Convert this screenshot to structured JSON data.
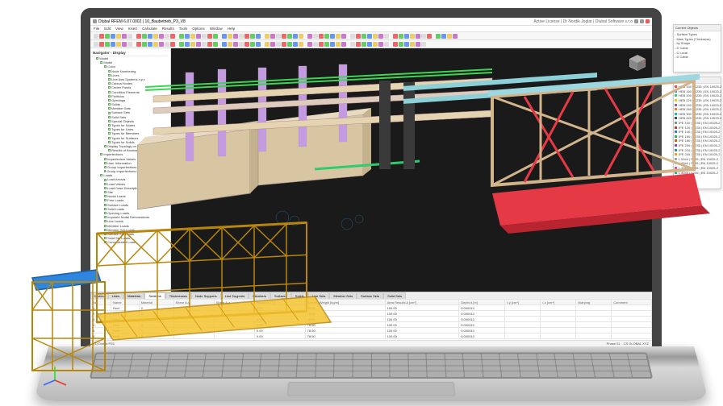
{
  "window": {
    "app_title": "Dlubal RFEM 6.07.0002 | 10_Baubetrieb_P3_V8",
    "user_status": "Active License | Dr Nordik Joglar | Dlubal Software s.r.o"
  },
  "menubar": [
    "File",
    "Edit",
    "View",
    "Insert",
    "Calculate",
    "Results",
    "Tools",
    "Options",
    "Window",
    "Help"
  ],
  "navigator": {
    "title": "Navigator - Display",
    "tree": [
      {
        "l": 1,
        "t": "Model",
        "exp": "-",
        "chk": true
      },
      {
        "l": 2,
        "t": "Model",
        "exp": "-",
        "chk": true
      },
      {
        "l": 3,
        "t": "Color",
        "exp": "-",
        "chk": true
      },
      {
        "l": 4,
        "t": "Node Numbering",
        "chk": true
      },
      {
        "l": 4,
        "t": "Lines",
        "chk": true
      },
      {
        "l": 4,
        "t": "Line Axis Systems x,y,z",
        "chk": true
      },
      {
        "l": 4,
        "t": "Cubical Nodes",
        "chk": true
      },
      {
        "l": 4,
        "t": "Center Points",
        "chk": true
      },
      {
        "l": 4,
        "t": "Condition Elements",
        "chk": true
      },
      {
        "l": 4,
        "t": "Fictitious",
        "chk": true
      },
      {
        "l": 4,
        "t": "Openings",
        "chk": true
      },
      {
        "l": 4,
        "t": "Solids",
        "chk": true
      },
      {
        "l": 4,
        "t": "Member Sets",
        "chk": true
      },
      {
        "l": 4,
        "t": "Surface Sets",
        "chk": true
      },
      {
        "l": 4,
        "t": "Solid Sets",
        "chk": true
      },
      {
        "l": 4,
        "t": "Special Objects",
        "chk": true
      },
      {
        "l": 4,
        "t": "Types for Nodes",
        "chk": true
      },
      {
        "l": 4,
        "t": "Types for Lines",
        "chk": true
      },
      {
        "l": 4,
        "t": "Types for Members",
        "chk": true
      },
      {
        "l": 4,
        "t": "Types for Surfaces",
        "chk": true
      },
      {
        "l": 4,
        "t": "Types for Solids",
        "chk": true
      },
      {
        "l": 3,
        "t": "Display Topology on",
        "chk": true
      },
      {
        "l": 4,
        "t": "Results of Boolean Operations",
        "chk": true
      },
      {
        "l": 2,
        "t": "Imperfections",
        "exp": "-",
        "chk": true
      },
      {
        "l": 3,
        "t": "Imperfection Values",
        "chk": true
      },
      {
        "l": 3,
        "t": "User Information",
        "chk": true
      },
      {
        "l": 3,
        "t": "Group Imperfections",
        "chk": true
      },
      {
        "l": 3,
        "t": "Group Imperfections to Load Cases & Com...",
        "chk": true
      },
      {
        "l": 2,
        "t": "Loads",
        "exp": "-",
        "chk": true
      },
      {
        "l": 3,
        "t": "Load Arrows",
        "chk": true
      },
      {
        "l": 3,
        "t": "Load Values",
        "chk": true
      },
      {
        "l": 3,
        "t": "Load Case Description",
        "chk": true
      },
      {
        "l": 3,
        "t": "Site",
        "chk": true
      },
      {
        "l": 3,
        "t": "Nodal Loads",
        "chk": true
      },
      {
        "l": 3,
        "t": "Free Loads",
        "chk": true
      },
      {
        "l": 3,
        "t": "Surface Loads",
        "chk": true
      },
      {
        "l": 3,
        "t": "Solid Loads",
        "chk": true
      },
      {
        "l": 3,
        "t": "Opening Loads",
        "chk": true
      },
      {
        "l": 3,
        "t": "Imposed Nodal Deformations",
        "chk": true
      },
      {
        "l": 3,
        "t": "Line Loads",
        "chk": true
      },
      {
        "l": 3,
        "t": "Member Loads",
        "chk": true
      },
      {
        "l": 3,
        "t": "Member Set Loads",
        "chk": true
      },
      {
        "l": 3,
        "t": "Surface Set Loads",
        "chk": true
      },
      {
        "l": 3,
        "t": "Solid Set Loads",
        "chk": true
      },
      {
        "l": 3,
        "t": "Concentrated Loads",
        "chk": true
      }
    ]
  },
  "bottom_tabs": [
    "Nodes",
    "Lines",
    "Materials",
    "Sections",
    "Thicknesses",
    "Node Supports",
    "Line Supports",
    "Members",
    "Surfaces",
    "Solids",
    "Line Sets",
    "Member Sets",
    "Surface Sets",
    "Solid Sets"
  ],
  "active_tab": "Sections",
  "table": {
    "columns": [
      "No.",
      "Name",
      "Material",
      "Shear A-y",
      "Shear A-z",
      "Rotation α [°]",
      "Specific Weight [kg/m]",
      "Area Results A [cm²]",
      "Depth d [m]",
      "I-y [cm⁴]",
      "I-z [cm⁴]",
      "Warping",
      "Comment"
    ],
    "rows": [
      [
        "1",
        "Rect",
        "2",
        "",
        "",
        "0.00",
        "78.50",
        "100.00",
        "0.000010",
        "",
        "",
        "",
        ""
      ],
      [
        "2",
        "Rect",
        "1",
        "",
        "",
        "0.00",
        "78.50",
        "100.00",
        "0.000010",
        "",
        "",
        "",
        ""
      ],
      [
        "3",
        "Rect",
        "1",
        "",
        "",
        "0.00",
        "78.50",
        "100.00",
        "0.000010",
        "",
        "",
        "",
        ""
      ],
      [
        "4",
        "Rect",
        "2",
        "",
        "",
        "0.00",
        "78.50",
        "100.00",
        "0.000010",
        "",
        "",
        "",
        ""
      ],
      [
        "5",
        "Rect",
        "1",
        "",
        "",
        "0.00",
        "78.50",
        "100.00",
        "0.000010",
        "",
        "",
        "",
        ""
      ],
      [
        "6",
        "Rect",
        "3",
        "",
        "",
        "0.00",
        "78.50",
        "100.00",
        "0.000010",
        "",
        "",
        "",
        ""
      ]
    ]
  },
  "status": {
    "model_tab": "(1) Dlubal P25",
    "phase": "Phase 01",
    "coords": "",
    "cs": "CS GLOBAL XYZ"
  },
  "float_panel_1": {
    "title": "Current Objects",
    "rows": [
      "- Surface Types",
      "- Main Types (Thickness)",
      "- by Shape",
      "- D Cable",
      "- D Local",
      "- D Cable"
    ]
  },
  "float_panel_2": {
    "title": "Materials",
    "rows": [
      {
        "c": "#e74c3c",
        "t": "HEB 140 | S235 | EN 10025-2"
      },
      {
        "c": "#3498db",
        "t": "HEB 160 | S235 | EN 10025-2"
      },
      {
        "c": "#2ecc71",
        "t": "HEB 200 | S235 | EN 10025-2"
      },
      {
        "c": "#f1c40f",
        "t": "HEB 220 | S235 | EN 10025-2"
      },
      {
        "c": "#9b59b6",
        "t": "HEB 240 | S235 | EN 10025-2"
      },
      {
        "c": "#e67e22",
        "t": "HEB 260 | S235 | EN 10025-2"
      },
      {
        "c": "#1abc9c",
        "t": "HEB 300 | S235 | EN 10025-2"
      },
      {
        "c": "#34495e",
        "t": "HEB 320 | S235 | EN 10025-2"
      },
      {
        "c": "#7f8c8d",
        "t": "IPE 100 | S235 | EN 10025-2"
      },
      {
        "c": "#c0392b",
        "t": "IPE 120 | S235 | EN 10025-2"
      },
      {
        "c": "#2980b9",
        "t": "IPE 140 | S235 | EN 10025-2"
      },
      {
        "c": "#27ae60",
        "t": "IPE 160 | S235 | EN 10025-2"
      },
      {
        "c": "#d35400",
        "t": "IPE 180 | S235 | EN 10025-2"
      },
      {
        "c": "#8e44ad",
        "t": "IPE 200 | S235 | EN 10025-2"
      },
      {
        "c": "#16a085",
        "t": "IPE 220 | S235 | EN 10025-2"
      },
      {
        "c": "#f39c12",
        "t": "IPE 240 | S235 | EN 10025-2"
      },
      {
        "c": "#95a5a6",
        "t": "L 50x5 | S235 | EN 10025-2"
      },
      {
        "c": "#bdc3c7",
        "t": "L 60x6 | S235 | EN 10025-2"
      },
      {
        "c": "#e84393",
        "t": "L 70x7 | S235 | EN 10025-2"
      },
      {
        "c": "#00b894",
        "t": "L 80x8 | S235 | EN 10025-2"
      }
    ]
  }
}
